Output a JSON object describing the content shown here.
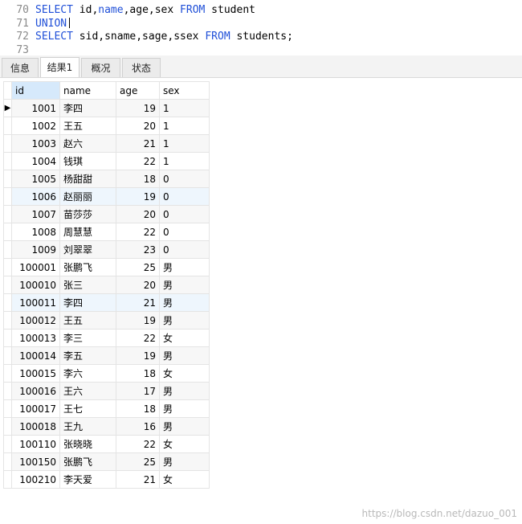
{
  "editor": {
    "lines": [
      {
        "num": "70",
        "tokens": [
          [
            "kw",
            "SELECT"
          ],
          [
            "tx",
            " id,"
          ],
          [
            "kw",
            "name"
          ],
          [
            "tx",
            ",age,sex "
          ],
          [
            "kw",
            "FROM"
          ],
          [
            "tx",
            " student"
          ]
        ]
      },
      {
        "num": "71",
        "tokens": [
          [
            "kw",
            "UNION"
          ]
        ],
        "cursor": true
      },
      {
        "num": "72",
        "tokens": [
          [
            "kw",
            "SELECT"
          ],
          [
            "tx",
            " sid,sname,sage,ssex "
          ],
          [
            "kw",
            "FROM"
          ],
          [
            "tx",
            " students;"
          ]
        ]
      },
      {
        "num": "73",
        "tokens": []
      }
    ]
  },
  "tabs": [
    {
      "label": "信息",
      "active": false
    },
    {
      "label": "结果1",
      "active": true
    },
    {
      "label": "概况",
      "active": false
    },
    {
      "label": "状态",
      "active": false
    }
  ],
  "table": {
    "headers": [
      "id",
      "name",
      "age",
      "sex"
    ],
    "selected_header": "id",
    "current_row_marker": "▶",
    "rows": [
      [
        "1001",
        "李四",
        "19",
        "1"
      ],
      [
        "1002",
        "王五",
        "20",
        "1"
      ],
      [
        "1003",
        "赵六",
        "21",
        "1"
      ],
      [
        "1004",
        "钱琪",
        "22",
        "1"
      ],
      [
        "1005",
        "杨甜甜",
        "18",
        "0"
      ],
      [
        "1006",
        "赵丽丽",
        "19",
        "0"
      ],
      [
        "1007",
        "苗莎莎",
        "20",
        "0"
      ],
      [
        "1008",
        "周慧慧",
        "22",
        "0"
      ],
      [
        "1009",
        "刘翠翠",
        "23",
        "0"
      ],
      [
        "100001",
        "张鹏飞",
        "25",
        "男"
      ],
      [
        "100010",
        "张三",
        "20",
        "男"
      ],
      [
        "100011",
        "李四",
        "21",
        "男"
      ],
      [
        "100012",
        "王五",
        "19",
        "男"
      ],
      [
        "100013",
        "李三",
        "22",
        "女"
      ],
      [
        "100014",
        "李五",
        "19",
        "男"
      ],
      [
        "100015",
        "李六",
        "18",
        "女"
      ],
      [
        "100016",
        "王六",
        "17",
        "男"
      ],
      [
        "100017",
        "王七",
        "18",
        "男"
      ],
      [
        "100018",
        "王九",
        "16",
        "男"
      ],
      [
        "100110",
        "张晓晓",
        "22",
        "女"
      ],
      [
        "100150",
        "张鹏飞",
        "25",
        "男"
      ],
      [
        "100210",
        "李天爱",
        "21",
        "女"
      ]
    ]
  },
  "watermark": "https://blog.csdn.net/dazuo_001"
}
